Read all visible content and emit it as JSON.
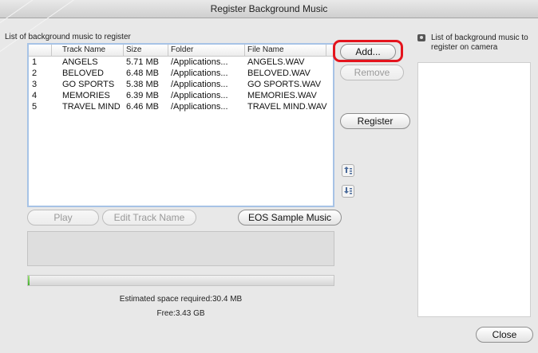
{
  "window": {
    "title": "Register Background Music"
  },
  "register_list": {
    "label": "List of background music to register",
    "columns": {
      "number": "",
      "track": "Track Name",
      "size": "Size",
      "folder": "Folder",
      "file": "File Name"
    },
    "rows": [
      {
        "num": "1",
        "track": "ANGELS",
        "size": "5.71 MB",
        "folder": "/Applications...",
        "file": "ANGELS.WAV"
      },
      {
        "num": "2",
        "track": "BELOVED",
        "size": "6.48 MB",
        "folder": "/Applications...",
        "file": "BELOVED.WAV"
      },
      {
        "num": "3",
        "track": "GO SPORTS",
        "size": "5.38 MB",
        "folder": "/Applications...",
        "file": "GO SPORTS.WAV"
      },
      {
        "num": "4",
        "track": "MEMORIES",
        "size": "6.39 MB",
        "folder": "/Applications...",
        "file": "MEMORIES.WAV"
      },
      {
        "num": "5",
        "track": "TRAVEL MIND",
        "size": "6.46 MB",
        "folder": "/Applications...",
        "file": "TRAVEL MIND.WAV"
      }
    ]
  },
  "buttons": {
    "add": "Add...",
    "remove": "Remove",
    "register": "Register",
    "play": "Play",
    "edit_track_name": "Edit Track Name",
    "eos_sample_music": "EOS Sample Music",
    "close": "Close"
  },
  "icons": {
    "move_up": "move-up-icon",
    "move_down": "move-down-icon",
    "camera": "camera-icon"
  },
  "progress": {
    "fraction": 0.005
  },
  "space": {
    "estimated": "Estimated space required:30.4 MB",
    "free": "Free:3.43 GB"
  },
  "camera_list": {
    "label_line1": "List of background music to",
    "label_line2": "register on camera"
  },
  "colors": {
    "highlight": "#e4141d",
    "list_border": "#a7c3e6",
    "progress": "#3fae2a"
  }
}
